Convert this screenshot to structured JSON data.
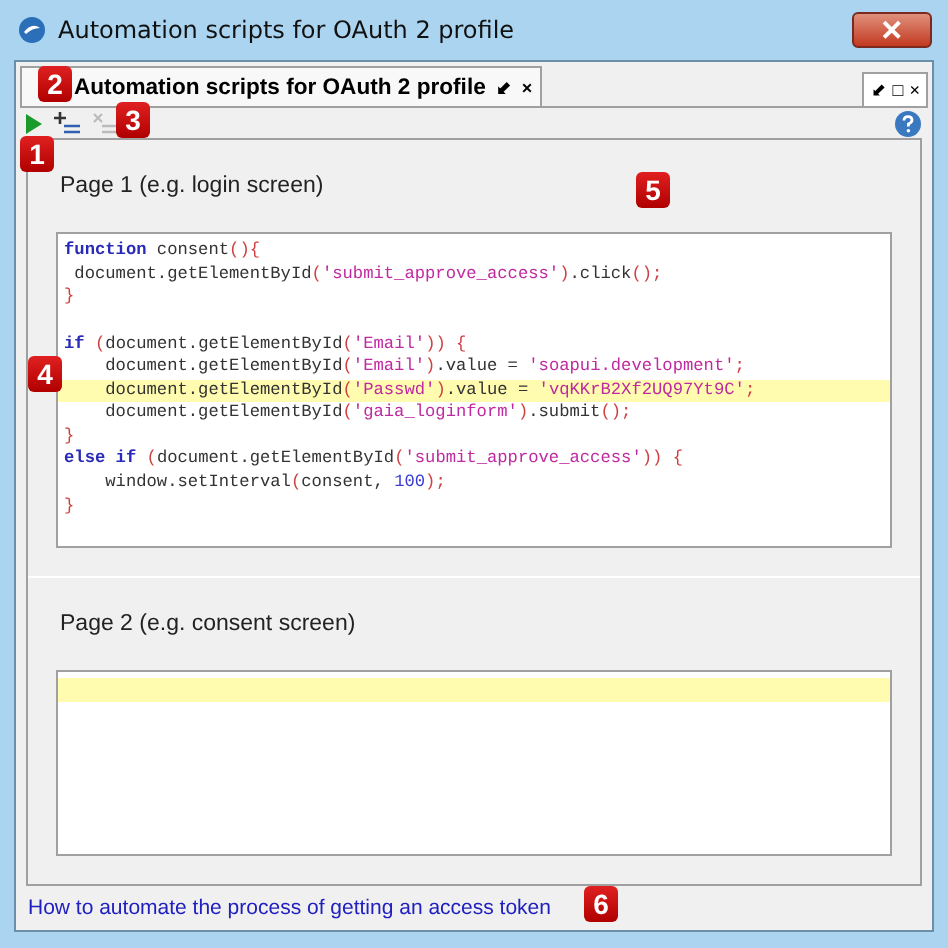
{
  "window": {
    "title": "Automation scripts for OAuth 2 profile",
    "close": "✕"
  },
  "tab": {
    "label": "Automation scripts for OAuth 2 profile",
    "selected": true,
    "pin": "⬋",
    "close": "×"
  },
  "panel_controls": {
    "pin": "⬋",
    "maximize": "□",
    "close": "×"
  },
  "toolbar": [
    {
      "kind": "run",
      "disabled": false
    },
    {
      "kind": "add",
      "disabled": false
    },
    {
      "kind": "remove",
      "disabled": true
    },
    {
      "kind": "help",
      "disabled": false
    }
  ],
  "pages": [
    {
      "label": "Page 1 (e.g. login screen)",
      "editor": {
        "lines": [
          {
            "highlighted": false,
            "tokens": [
              {
                "kind": "keyword",
                "text": "function"
              },
              {
                "kind": "plain",
                "text": " consent"
              },
              {
                "kind": "punct",
                "text": "(){"
              }
            ]
          },
          {
            "highlighted": false,
            "tokens": [
              {
                "kind": "plain",
                "text": " document.getElementById"
              },
              {
                "kind": "punct",
                "text": "("
              },
              {
                "kind": "string",
                "text": "'submit_approve_access'"
              },
              {
                "kind": "punct",
                "text": ")"
              },
              {
                "kind": "plain",
                "text": ".click"
              },
              {
                "kind": "punct",
                "text": "();"
              }
            ]
          },
          {
            "highlighted": false,
            "tokens": [
              {
                "kind": "punct",
                "text": "}"
              }
            ]
          },
          {
            "highlighted": false
          },
          {
            "highlighted": false,
            "tokens": [
              {
                "kind": "keyword",
                "text": "if"
              },
              {
                "kind": "punct",
                "text": " ("
              },
              {
                "kind": "plain",
                "text": "document.getElementById"
              },
              {
                "kind": "punct",
                "text": "("
              },
              {
                "kind": "string",
                "text": "'Email'"
              },
              {
                "kind": "punct",
                "text": ")) {"
              }
            ]
          },
          {
            "highlighted": false,
            "tokens": [
              {
                "kind": "plain",
                "text": "    document.getElementById"
              },
              {
                "kind": "punct",
                "text": "("
              },
              {
                "kind": "string",
                "text": "'Email'"
              },
              {
                "kind": "punct",
                "text": ")"
              },
              {
                "kind": "plain",
                "text": ".value = "
              },
              {
                "kind": "string",
                "text": "'soapui.development'"
              },
              {
                "kind": "punct",
                "text": ";"
              }
            ]
          },
          {
            "highlighted": true,
            "tokens": [
              {
                "kind": "plain",
                "text": "    document.getElementById"
              },
              {
                "kind": "punct",
                "text": "("
              },
              {
                "kind": "string",
                "text": "'Passwd'"
              },
              {
                "kind": "punct",
                "text": ")"
              },
              {
                "kind": "plain",
                "text": ".value = "
              },
              {
                "kind": "string",
                "text": "'vqKKrB2Xf2UQ97Yt9C'"
              },
              {
                "kind": "punct",
                "text": ";"
              }
            ]
          },
          {
            "highlighted": false,
            "tokens": [
              {
                "kind": "plain",
                "text": "    document.getElementById"
              },
              {
                "kind": "punct",
                "text": "("
              },
              {
                "kind": "string",
                "text": "'gaia_loginform'"
              },
              {
                "kind": "punct",
                "text": ")"
              },
              {
                "kind": "plain",
                "text": ".submit"
              },
              {
                "kind": "punct",
                "text": "();"
              }
            ]
          },
          {
            "highlighted": false,
            "tokens": [
              {
                "kind": "punct",
                "text": "}"
              }
            ]
          },
          {
            "highlighted": false,
            "tokens": [
              {
                "kind": "keyword",
                "text": "else if"
              },
              {
                "kind": "punct",
                "text": " ("
              },
              {
                "kind": "plain",
                "text": "document.getElementById"
              },
              {
                "kind": "punct",
                "text": "("
              },
              {
                "kind": "string",
                "text": "'submit_approve_access'"
              },
              {
                "kind": "punct",
                "text": ")) {"
              }
            ]
          },
          {
            "highlighted": false,
            "tokens": [
              {
                "kind": "plain",
                "text": "    window.setInterval"
              },
              {
                "kind": "punct",
                "text": "("
              },
              {
                "kind": "plain",
                "text": "consent, "
              },
              {
                "kind": "number",
                "text": "100"
              },
              {
                "kind": "punct",
                "text": ");"
              }
            ]
          },
          {
            "highlighted": false,
            "tokens": [
              {
                "kind": "punct",
                "text": "}"
              }
            ]
          }
        ]
      }
    },
    {
      "label": "Page 2 (e.g. consent screen)",
      "editor": {
        "lines": [
          {
            "highlighted": true
          }
        ]
      }
    }
  ],
  "footer_link": "How to automate the process of getting an access token",
  "callouts": [
    "1",
    "2",
    "3",
    "4",
    "5",
    "6"
  ]
}
